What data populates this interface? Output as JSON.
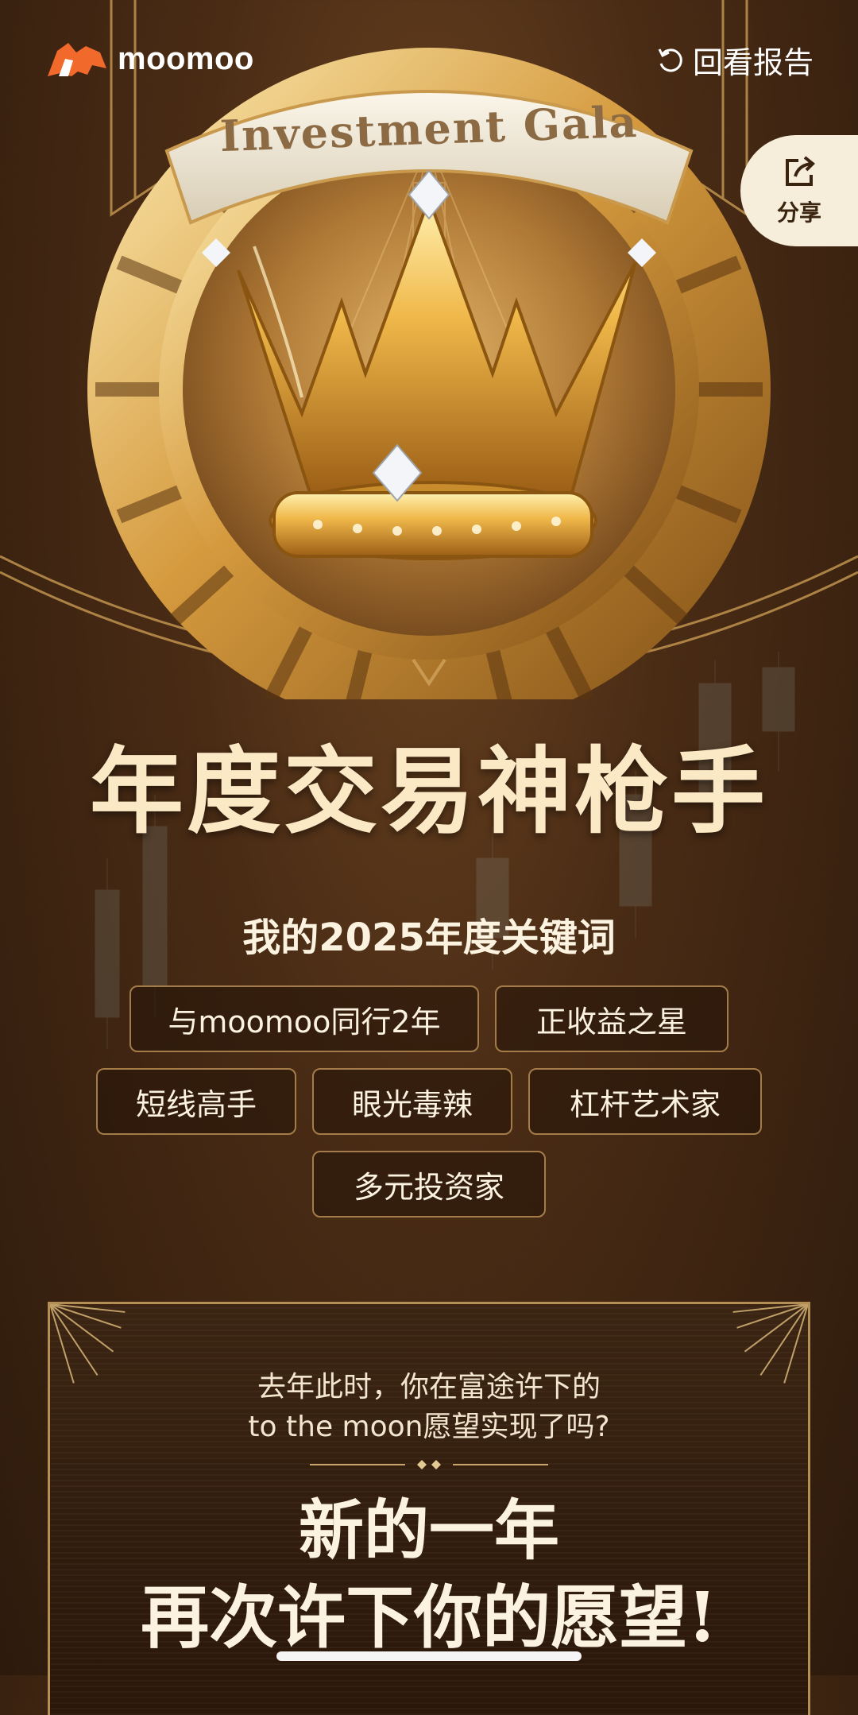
{
  "header": {
    "brand": "moomoo",
    "review_label": "回看报告"
  },
  "share": {
    "label": "分享"
  },
  "badge": {
    "banner_text": "Investment Gala"
  },
  "main_title": "年度交易神枪手",
  "subtitle": "我的2025年度关键词",
  "keywords": [
    [
      "与moomoo同行2年",
      "正收益之星"
    ],
    [
      "短线高手",
      "眼光毒辣",
      "杠杆艺术家"
    ],
    [
      "多元投资家"
    ]
  ],
  "card": {
    "line1": "去年此时，你在富途许下的",
    "line2": "to the moon愿望实现了吗?",
    "headline_1": "新的一年",
    "headline_2": "再次许下你的愿望!"
  },
  "colors": {
    "accent_gold": "#d9a94e",
    "brand_orange": "#f26a2b",
    "background": "#4a2c15"
  }
}
